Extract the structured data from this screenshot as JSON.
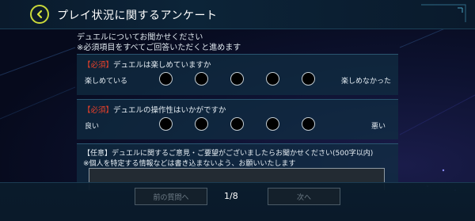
{
  "header": {
    "title": "プレイ状況に関するアンケート"
  },
  "intro": {
    "line1": "デュエルについてお聞かせください",
    "line2": "※必須項目をすべてご回答いただくと進めます"
  },
  "questions": [
    {
      "required_tag": "【必須】",
      "text": "デュエルは楽しめていますか",
      "low_label": "楽しめている",
      "high_label": "楽しめなかった",
      "options_count": 5
    },
    {
      "required_tag": "【必須】",
      "text": "デュエルの操作性はいかがですか",
      "low_label": "良い",
      "high_label": "悪い",
      "options_count": 5
    }
  ],
  "free_text": {
    "title": "【任意】デュエルに関するご意見・ご要望がございましたらお聞かせください(500字以内)",
    "note": "※個人を特定する情報などは書き込まないよう、お願いいたします",
    "value": ""
  },
  "footer": {
    "prev_label": "前の質問へ",
    "next_label": "次へ",
    "page_indicator": "1/8"
  },
  "colors": {
    "accent_yellow": "#c9d83a",
    "required_red": "#e8402a",
    "panel": "#112e42"
  },
  "icons": {
    "back": "chevron-left-icon",
    "ornament": "corner-ornament-icon"
  }
}
